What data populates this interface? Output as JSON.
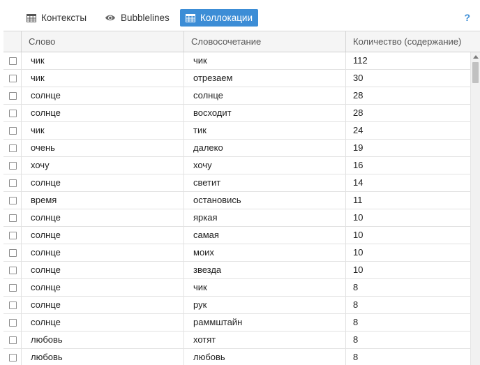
{
  "toolbar": {
    "tabs": [
      {
        "label": "Контексты",
        "icon": "table-icon",
        "active": false
      },
      {
        "label": "Bubblelines",
        "icon": "eye-icon",
        "active": false
      },
      {
        "label": "Коллокации",
        "icon": "table-icon",
        "active": true
      }
    ],
    "help": "?"
  },
  "colors": {
    "accent": "#3c8dd6",
    "header_bg": "#f5f5f5"
  },
  "table": {
    "columns": [
      "Слово",
      "Словосочетание",
      "Количество (содержание)"
    ],
    "rows": [
      [
        "чик",
        "чик",
        "112"
      ],
      [
        "чик",
        "отрезаем",
        "30"
      ],
      [
        "солнце",
        "солнце",
        "28"
      ],
      [
        "солнце",
        "восходит",
        "28"
      ],
      [
        "чик",
        "тик",
        "24"
      ],
      [
        "очень",
        "далеко",
        "19"
      ],
      [
        "хочу",
        "хочу",
        "16"
      ],
      [
        "солнце",
        "светит",
        "14"
      ],
      [
        "время",
        "остановись",
        "11"
      ],
      [
        "солнце",
        "яркая",
        "10"
      ],
      [
        "солнце",
        "самая",
        "10"
      ],
      [
        "солнце",
        "моих",
        "10"
      ],
      [
        "солнце",
        "звезда",
        "10"
      ],
      [
        "солнце",
        "чик",
        "8"
      ],
      [
        "солнце",
        "рук",
        "8"
      ],
      [
        "солнце",
        "раммштайн",
        "8"
      ],
      [
        "любовь",
        "хотят",
        "8"
      ],
      [
        "любовь",
        "любовь",
        "8"
      ]
    ]
  }
}
